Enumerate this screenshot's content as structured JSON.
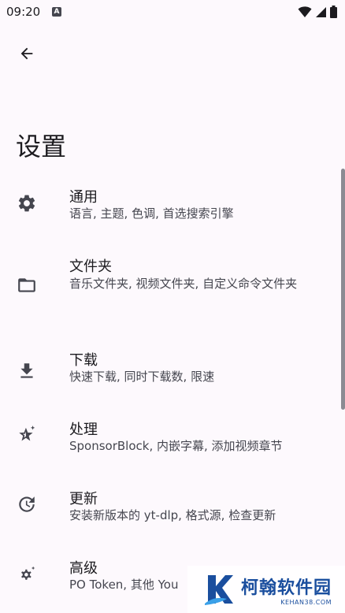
{
  "status_bar": {
    "time": "09:20",
    "badge": "A"
  },
  "header": {
    "title": "设置"
  },
  "settings": [
    {
      "title": "通用",
      "desc": "语言, 主题, 色调, 首选搜索引擎",
      "icon": "gear-icon"
    },
    {
      "title": "文件夹",
      "desc": "音乐文件夹, 视频文件夹, 自定义命令文件夹",
      "icon": "folder-icon"
    },
    {
      "title": "下载",
      "desc": "快速下载, 同时下载数, 限速",
      "icon": "download-icon"
    },
    {
      "title": "处理",
      "desc": "SponsorBlock, 内嵌字幕, 添加视频章节",
      "icon": "star-sparkle-icon"
    },
    {
      "title": "更新",
      "desc": "安装新版本的 yt-dlp, 格式源, 检查更新",
      "icon": "update-icon"
    },
    {
      "title": "高级",
      "desc": "PO Token, 其他 You",
      "icon": "advanced-gear-icon"
    }
  ],
  "watermark": {
    "text": "柯翰软件园",
    "sub": "KEHAN38.COM"
  },
  "colors": {
    "background": "#fdf9fd",
    "text_primary": "#1c1b1f",
    "text_secondary": "#45464f",
    "icon": "#45464f"
  }
}
